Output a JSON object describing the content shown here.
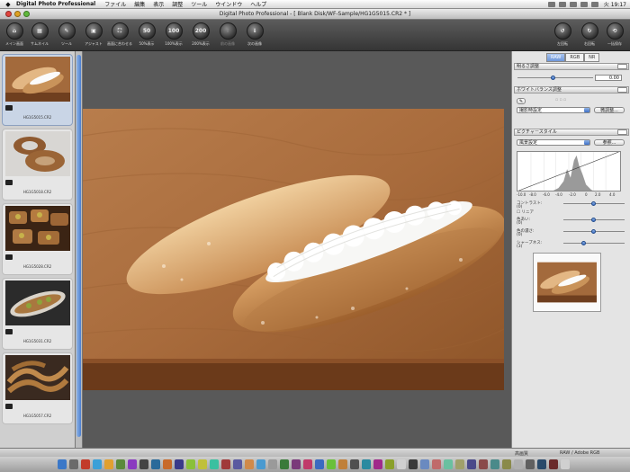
{
  "menubar": {
    "app_name": "Digital Photo Professional",
    "items": [
      "ファイル",
      "編集",
      "表示",
      "調整",
      "ツール",
      "ウインドウ",
      "ヘルプ"
    ],
    "clock": "火 19:17"
  },
  "window": {
    "title": "Digital Photo Professional - [ Blank Disk/WF-Sample/HG1G5015.CR2 * ]"
  },
  "toolbar": {
    "items": [
      {
        "label": "メイン画面",
        "glyph": "⌂"
      },
      {
        "label": "サムネイル",
        "glyph": "▦"
      },
      {
        "label": "ツール",
        "glyph": "✎"
      },
      {
        "label": "アジャスト",
        "glyph": "▣"
      },
      {
        "label": "画面に合わせる",
        "glyph": "⛶"
      },
      {
        "label": "50%表示",
        "glyph": "50"
      },
      {
        "label": "100%表示",
        "glyph": "100"
      },
      {
        "label": "200%表示",
        "glyph": "200"
      },
      {
        "label": "前の画像",
        "glyph": "⇑"
      },
      {
        "label": "次の画像",
        "glyph": "⇓"
      }
    ],
    "right_items": [
      {
        "label": "左回転",
        "glyph": "↺"
      },
      {
        "label": "右回転",
        "glyph": "↻"
      },
      {
        "label": "一括保存",
        "glyph": "⟲"
      }
    ]
  },
  "filmstrip": {
    "items": [
      {
        "filename": "HG1G5015.CR2",
        "selected": true,
        "rating": "RAW"
      },
      {
        "filename": "HG1G5018.CR2",
        "selected": false,
        "rating": "RAW"
      },
      {
        "filename": "HG1G5028.CR2",
        "selected": false,
        "rating": "RAW"
      },
      {
        "filename": "HG1G5031.CR2",
        "selected": false,
        "rating": "RAW"
      },
      {
        "filename": "HG1G5057.CR2",
        "selected": false,
        "rating": "RAW"
      }
    ]
  },
  "tool_palette": {
    "tabs": [
      "RAW",
      "RGB",
      "NR"
    ],
    "active_tab": "RAW",
    "brightness": {
      "title": "明るさ調整",
      "value": "0.00"
    },
    "white_balance": {
      "title": "ホワイトバランス調整",
      "select": "撮影時設定",
      "adjust_button": "微調整..."
    },
    "picture_style": {
      "title": "ピクチャースタイル",
      "select": "風景設定",
      "browse_button": "参照...",
      "histogram_ticks": [
        "-10.0",
        "-8.0",
        "-6.0",
        "-4.0",
        "-2.0",
        "0",
        "2.0",
        "4.0"
      ],
      "linear_label": "リニア",
      "contrast_label": "コントラスト:",
      "contrast_value": "(0)",
      "tone_label": "色あい:",
      "tone_value": "(0)",
      "saturation_label": "色の濃さ:",
      "saturation_value": "(0)",
      "sharpness_label": "シャープネス:",
      "sharpness_value": "(3)"
    }
  },
  "status_bar": {
    "left": "高画質",
    "right": "RAW / Adobe RGB"
  },
  "colors": {
    "accent": "#4b7fcf",
    "toolbar_bg": "#3f3f3f",
    "canvas_bg": "#595959"
  }
}
